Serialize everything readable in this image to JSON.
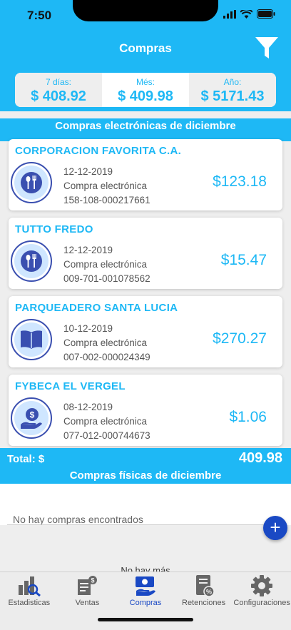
{
  "status": {
    "time": "7:50"
  },
  "header": {
    "title": "Compras"
  },
  "summary": [
    {
      "label": "7 días:",
      "value": "$ 408.92"
    },
    {
      "label": "Més:",
      "value": "$ 409.98"
    },
    {
      "label": "Año:",
      "value": "$ 5171.43"
    }
  ],
  "section_electronic": "Compras electrónicas de diciembre",
  "purchases": [
    {
      "name": "CORPORACION FAVORITA C.A.",
      "date": "12-12-2019",
      "type": "Compra electrónica",
      "number": "158-108-000217661",
      "amount": "$123.18",
      "icon": "restaurant-icon"
    },
    {
      "name": "TUTTO FREDO",
      "date": "12-12-2019",
      "type": "Compra electrónica",
      "number": "009-701-001078562",
      "amount": "$15.47",
      "icon": "restaurant-icon"
    },
    {
      "name": "PARQUEADERO SANTA LUCIA",
      "date": "10-12-2019",
      "type": "Compra electrónica",
      "number": "007-002-000024349",
      "amount": "$270.27",
      "icon": "book-icon"
    },
    {
      "name": "FYBECA EL VERGEL",
      "date": "08-12-2019",
      "type": "Compra electrónica",
      "number": "077-012-000744673",
      "amount": "$1.06",
      "icon": "money-hand-icon"
    }
  ],
  "total": {
    "label": "Total: $",
    "value": "409.98"
  },
  "section_physical": "Compras físicas de diciembre",
  "empty_message": "No hay compras encontrados",
  "add_label": "+",
  "no_more": "No hay más",
  "tabs": [
    {
      "label": "Estadisticas",
      "icon": "stats-icon",
      "active": false
    },
    {
      "label": "Ventas",
      "icon": "sales-icon",
      "active": false
    },
    {
      "label": "Compras",
      "icon": "purchases-icon",
      "active": true
    },
    {
      "label": "Retenciones",
      "icon": "retentions-icon",
      "active": false
    },
    {
      "label": "Configuraciones",
      "icon": "gear-icon",
      "active": false
    }
  ],
  "colors": {
    "accent": "#1eb8f5",
    "active": "#1a49c4",
    "icon_bg": "#cfe6ff"
  }
}
